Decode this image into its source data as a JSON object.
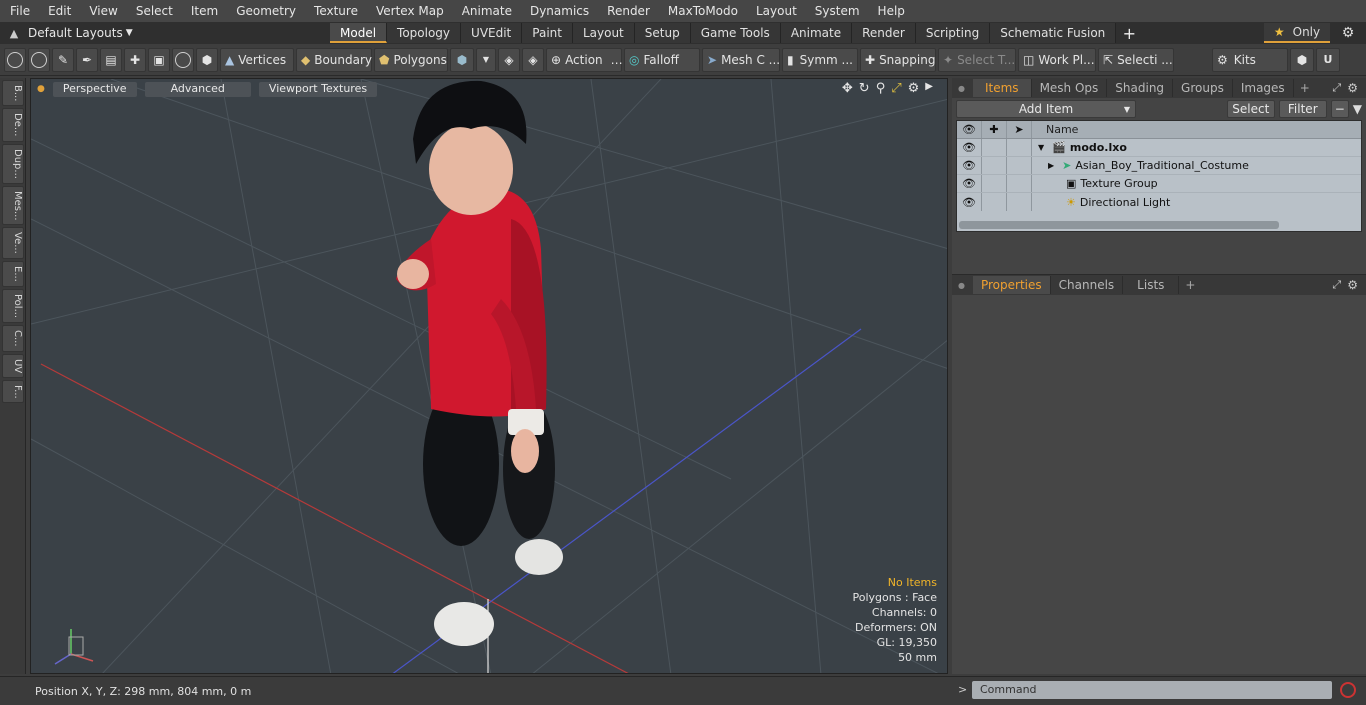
{
  "menu": [
    "File",
    "Edit",
    "View",
    "Select",
    "Item",
    "Geometry",
    "Texture",
    "Vertex Map",
    "Animate",
    "Dynamics",
    "Render",
    "MaxToModo",
    "Layout",
    "System",
    "Help"
  ],
  "layout": {
    "selector": "Default Layouts",
    "tabs": [
      "Model",
      "Topology",
      "UVEdit",
      "Paint",
      "Layout",
      "Setup",
      "Game Tools",
      "Animate",
      "Render",
      "Scripting",
      "Schematic Fusion"
    ],
    "active_tab": "Model",
    "only_label": "Only"
  },
  "toolbar": {
    "vertices": "Vertices",
    "boundary": "Boundary",
    "polygons": "Polygons",
    "action": "Action",
    "falloff": "Falloff",
    "mesh": "Mesh C ...",
    "symm": "Symm ...",
    "snapping": "Snapping",
    "select_t": "Select T...",
    "work_pl": "Work Pl...",
    "selecti": "Selecti ...",
    "kits": "Kits"
  },
  "left_tabs": [
    "B...",
    "De...",
    "Dup...",
    "Mes...",
    "Ve...",
    "E...",
    "Pol...",
    "C...",
    "UV",
    "F..."
  ],
  "viewport": {
    "perspective": "Perspective",
    "advanced": "Advanced",
    "viewport_textures": "Viewport Textures",
    "info": {
      "no_items": "No Items",
      "polygons": "Polygons : Face",
      "channels": "Channels: 0",
      "deformers": "Deformers: ON",
      "gl": "GL: 19,350",
      "focal": "50 mm"
    }
  },
  "items_panel": {
    "tabs": [
      "Items",
      "Mesh Ops",
      "Shading",
      "Groups",
      "Images"
    ],
    "active": "Items",
    "add_item": "Add Item",
    "select": "Select",
    "filter": "Filter",
    "name_header": "Name",
    "rows": [
      "modo.lxo",
      "Asian_Boy_Traditional_Costume",
      "Texture Group",
      "Directional Light"
    ]
  },
  "props_panel": {
    "tabs": [
      "Properties",
      "Channels",
      "Lists"
    ],
    "active": "Properties"
  },
  "status": {
    "position": "Position X, Y, Z:  298 mm, 804 mm, 0 m",
    "command_placeholder": "Command"
  },
  "colors": {
    "accent": "#e0a13a",
    "item_tab": "#f0a030",
    "viewport_bg": "#3a4147",
    "shirt": "#d0182e"
  }
}
